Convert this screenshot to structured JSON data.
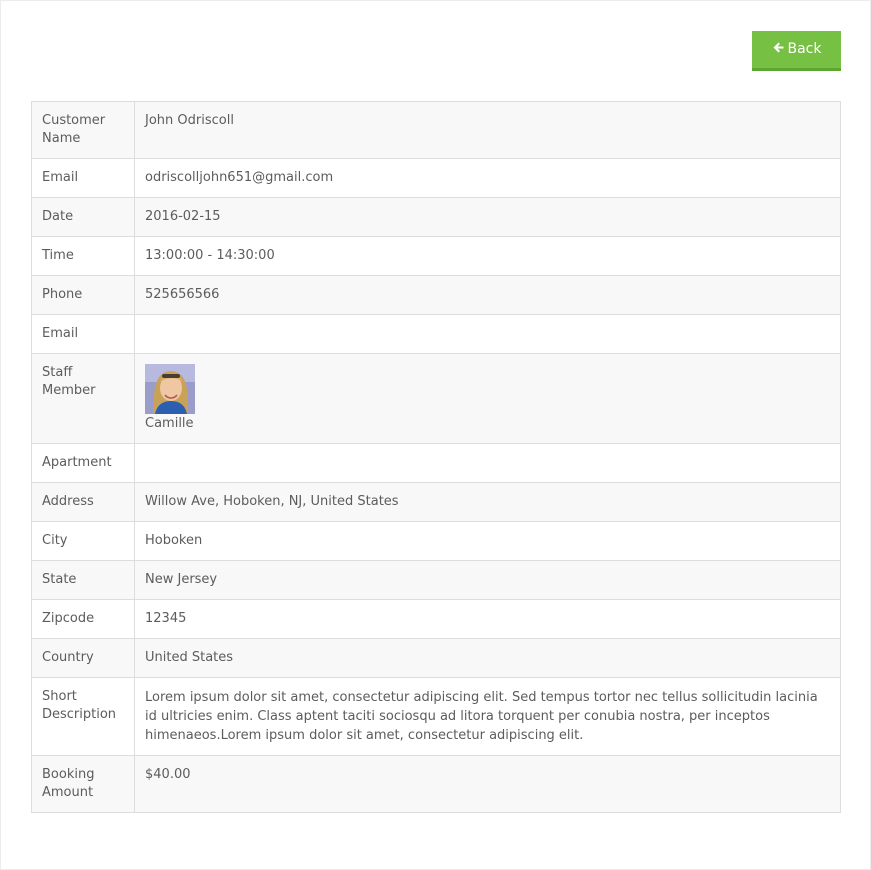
{
  "back_button": {
    "label": "Back",
    "icon": "arrow-left-icon",
    "color": "#76c043"
  },
  "rows": [
    {
      "label": "Customer Name",
      "value": "John Odriscoll"
    },
    {
      "label": "Email",
      "value": "odriscolljohn651@gmail.com"
    },
    {
      "label": "Date",
      "value": "2016-02-15"
    },
    {
      "label": "Time",
      "value": "13:00:00 - 14:30:00"
    },
    {
      "label": "Phone",
      "value": "525656566"
    },
    {
      "label": "Email",
      "value": ""
    },
    {
      "label": "Staff Member",
      "value": "Camille"
    },
    {
      "label": "Apartment",
      "value": ""
    },
    {
      "label": "Address",
      "value": "Willow Ave, Hoboken, NJ, United States"
    },
    {
      "label": "City",
      "value": "Hoboken"
    },
    {
      "label": "State",
      "value": "New Jersey"
    },
    {
      "label": "Zipcode",
      "value": "12345"
    },
    {
      "label": "Country",
      "value": "United States"
    },
    {
      "label": "Short Description",
      "value": "Lorem ipsum dolor sit amet, consectetur adipiscing elit. Sed tempus tortor nec tellus sollicitudin lacinia id ultricies enim. Class aptent taciti sociosqu ad litora torquent per conubia nostra, per inceptos himenaeos.Lorem ipsum dolor sit amet, consectetur adipiscing elit."
    },
    {
      "label": "Booking Amount",
      "value": "$40.00"
    }
  ]
}
